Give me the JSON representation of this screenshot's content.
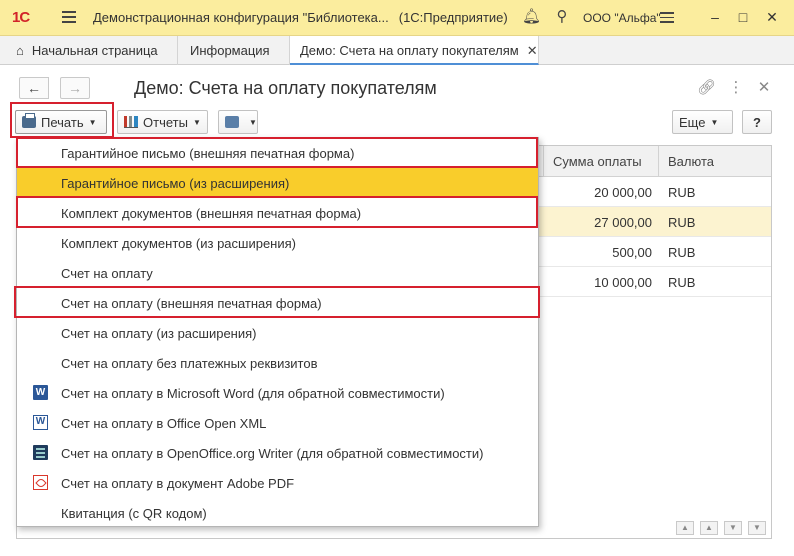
{
  "titlebar": {
    "logo": "1С",
    "title": "Демонстрационная конфигурация \"Библиотека...",
    "app": "(1С:Предприятие)",
    "org": "ООО \"Альфа\""
  },
  "tabs": {
    "home": "Начальная страница",
    "info": "Информация",
    "active": "Демо: Счета на оплату покупателям"
  },
  "form": {
    "title": "Демо: Счета на оплату покупателям",
    "print_label": "Печать",
    "reports_label": "Отчеты",
    "more_label": "Еще",
    "help_label": "?"
  },
  "table": {
    "columns": [
      "Сумма оплаты",
      "Валюта"
    ],
    "rows": [
      {
        "sum": "20 000,00",
        "currency": "RUB",
        "selected": false
      },
      {
        "sum": "27 000,00",
        "currency": "RUB",
        "selected": true
      },
      {
        "sum": "500,00",
        "currency": "RUB",
        "selected": false
      },
      {
        "sum": "10 000,00",
        "currency": "RUB",
        "selected": false
      }
    ]
  },
  "print_menu": {
    "items": [
      {
        "label": "Гарантийное письмо (внешняя печатная форма)",
        "icon": "",
        "highlighted": false,
        "marked": true
      },
      {
        "label": "Гарантийное письмо (из расширения)",
        "icon": "",
        "highlighted": true,
        "marked": false
      },
      {
        "label": "Комплект документов (внешняя печатная форма)",
        "icon": "",
        "highlighted": false,
        "marked": true
      },
      {
        "label": "Комплект документов (из расширения)",
        "icon": "",
        "highlighted": false,
        "marked": false
      },
      {
        "label": "Счет на оплату",
        "icon": "",
        "highlighted": false,
        "marked": false
      },
      {
        "label": "Счет на оплату (внешняя печатная форма)",
        "icon": "",
        "highlighted": false,
        "marked": true
      },
      {
        "label": "Счет на оплату (из расширения)",
        "icon": "",
        "highlighted": false,
        "marked": false
      },
      {
        "label": "Счет на оплату без платежных реквизитов",
        "icon": "",
        "highlighted": false,
        "marked": false
      },
      {
        "label": "Счет на оплату в Microsoft Word (для обратной совместимости)",
        "icon": "word-icon",
        "highlighted": false,
        "marked": false
      },
      {
        "label": "Счет на оплату в Office Open XML",
        "icon": "office-open-xml-icon",
        "highlighted": false,
        "marked": false
      },
      {
        "label": "Счет на оплату в OpenOffice.org Writer (для обратной совместимости)",
        "icon": "openoffice-writer-icon",
        "highlighted": false,
        "marked": false
      },
      {
        "label": "Счет на оплату в документ Adobe PDF",
        "icon": "pdf-icon",
        "highlighted": false,
        "marked": false
      },
      {
        "label": "Квитанция (с QR кодом)",
        "icon": "",
        "highlighted": false,
        "marked": false
      }
    ]
  },
  "colors": {
    "titlebar_bg": "#fbed9e",
    "highlight": "#f9cd2b",
    "selected_row": "#fcf3d0",
    "annotation_red": "#d6202e",
    "active_tab_underline": "#4f8fd6"
  }
}
